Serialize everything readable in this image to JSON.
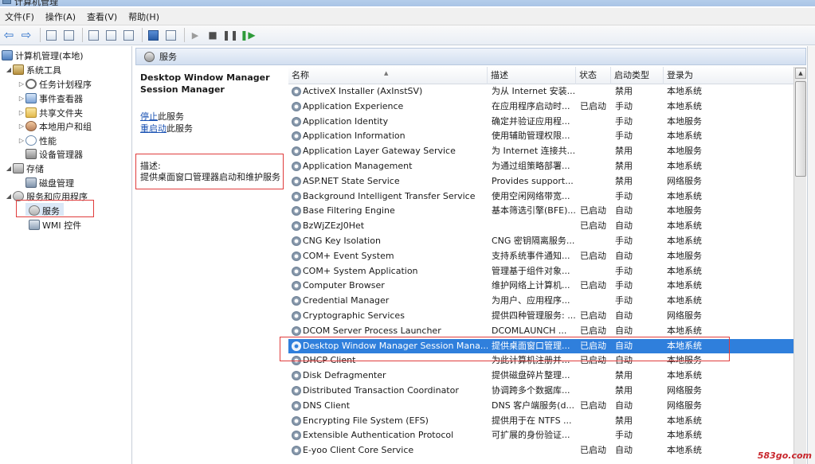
{
  "window": {
    "title": "计算机管理"
  },
  "menu": [
    "文件(F)",
    "操作(A)",
    "查看(V)",
    "帮助(H)"
  ],
  "toolbar": {
    "icons": [
      "back-icon",
      "forward-icon",
      "up-icon",
      "show-tree-icon",
      "export-icon",
      "refresh-icon",
      "export-list-icon",
      "help-icon",
      "properties-icon",
      "start-service-icon",
      "stop-service-icon",
      "pause-service-icon",
      "restart-service-icon"
    ]
  },
  "tree": {
    "root": "计算机管理(本地)",
    "system_tools": "系统工具",
    "task_scheduler": "任务计划程序",
    "event_viewer": "事件查看器",
    "shared_folders": "共享文件夹",
    "local_users": "本地用户和组",
    "performance": "性能",
    "device_manager": "设备管理器",
    "storage": "存储",
    "disk_management": "磁盘管理",
    "services_apps": "服务和应用程序",
    "services": "服务",
    "wmi": "WMI 控件"
  },
  "pane": {
    "header": "服务"
  },
  "desc": {
    "service_name": "Desktop Window Manager Session Manager",
    "stop_link": "停止",
    "stop_suffix": "此服务",
    "restart_link": "重启动",
    "restart_suffix": "此服务",
    "desc_label": "描述:",
    "desc_text": "提供桌面窗口管理器启动和维护服务"
  },
  "list": {
    "columns": {
      "name": "名称",
      "description": "描述",
      "status": "状态",
      "startup": "启动类型",
      "logon": "登录为"
    },
    "rows": [
      {
        "name": "ActiveX Installer (AxInstSV)",
        "desc": "为从 Internet 安装...",
        "status": "",
        "startup": "禁用",
        "logon": "本地系统"
      },
      {
        "name": "Application Experience",
        "desc": "在应用程序启动时...",
        "status": "已启动",
        "startup": "手动",
        "logon": "本地系统"
      },
      {
        "name": "Application Identity",
        "desc": "确定并验证应用程...",
        "status": "",
        "startup": "手动",
        "logon": "本地服务"
      },
      {
        "name": "Application Information",
        "desc": "使用辅助管理权限...",
        "status": "",
        "startup": "手动",
        "logon": "本地系统"
      },
      {
        "name": "Application Layer Gateway Service",
        "desc": "为 Internet 连接共...",
        "status": "",
        "startup": "禁用",
        "logon": "本地服务"
      },
      {
        "name": "Application Management",
        "desc": "为通过组策略部署...",
        "status": "",
        "startup": "禁用",
        "logon": "本地系统"
      },
      {
        "name": "ASP.NET State Service",
        "desc": "Provides support...",
        "status": "",
        "startup": "禁用",
        "logon": "网络服务"
      },
      {
        "name": "Background Intelligent Transfer Service",
        "desc": "使用空闲网络带宽...",
        "status": "",
        "startup": "手动",
        "logon": "本地系统"
      },
      {
        "name": "Base Filtering Engine",
        "desc": "基本筛选引擎(BFE)...",
        "status": "已启动",
        "startup": "自动",
        "logon": "本地服务"
      },
      {
        "name": "BzWjZEzJ0Het",
        "desc": "",
        "status": "已启动",
        "startup": "自动",
        "logon": "本地系统"
      },
      {
        "name": "CNG Key Isolation",
        "desc": "CNG 密钥隔离服务...",
        "status": "",
        "startup": "手动",
        "logon": "本地系统"
      },
      {
        "name": "COM+ Event System",
        "desc": "支持系统事件通知...",
        "status": "已启动",
        "startup": "自动",
        "logon": "本地服务"
      },
      {
        "name": "COM+ System Application",
        "desc": "管理基于组件对象...",
        "status": "",
        "startup": "手动",
        "logon": "本地系统"
      },
      {
        "name": "Computer Browser",
        "desc": "维护网络上计算机...",
        "status": "已启动",
        "startup": "手动",
        "logon": "本地系统"
      },
      {
        "name": "Credential Manager",
        "desc": "为用户、应用程序...",
        "status": "",
        "startup": "手动",
        "logon": "本地系统"
      },
      {
        "name": "Cryptographic Services",
        "desc": "提供四种管理服务: ...",
        "status": "已启动",
        "startup": "自动",
        "logon": "网络服务"
      },
      {
        "name": "DCOM Server Process Launcher",
        "desc": "DCOMLAUNCH ...",
        "status": "已启动",
        "startup": "自动",
        "logon": "本地系统"
      },
      {
        "name": "Desktop Window Manager Session Mana...",
        "desc": "提供桌面窗口管理...",
        "status": "已启动",
        "startup": "自动",
        "logon": "本地系统",
        "selected": true
      },
      {
        "name": "DHCP Client",
        "desc": "为此计算机注册并...",
        "status": "已启动",
        "startup": "自动",
        "logon": "本地服务"
      },
      {
        "name": "Disk Defragmenter",
        "desc": "提供磁盘碎片整理...",
        "status": "",
        "startup": "禁用",
        "logon": "本地系统"
      },
      {
        "name": "Distributed Transaction Coordinator",
        "desc": "协调跨多个数据库...",
        "status": "",
        "startup": "禁用",
        "logon": "网络服务"
      },
      {
        "name": "DNS Client",
        "desc": "DNS 客户端服务(d...",
        "status": "已启动",
        "startup": "自动",
        "logon": "网络服务"
      },
      {
        "name": "Encrypting File System (EFS)",
        "desc": "提供用于在 NTFS ...",
        "status": "",
        "startup": "禁用",
        "logon": "本地系统"
      },
      {
        "name": "Extensible Authentication Protocol",
        "desc": "可扩展的身份验证...",
        "status": "",
        "startup": "手动",
        "logon": "本地系统"
      },
      {
        "name": "E-yoo Client Core Service",
        "desc": "",
        "status": "已启动",
        "startup": "自动",
        "logon": "本地系统"
      }
    ]
  },
  "watermark": "583go.com"
}
